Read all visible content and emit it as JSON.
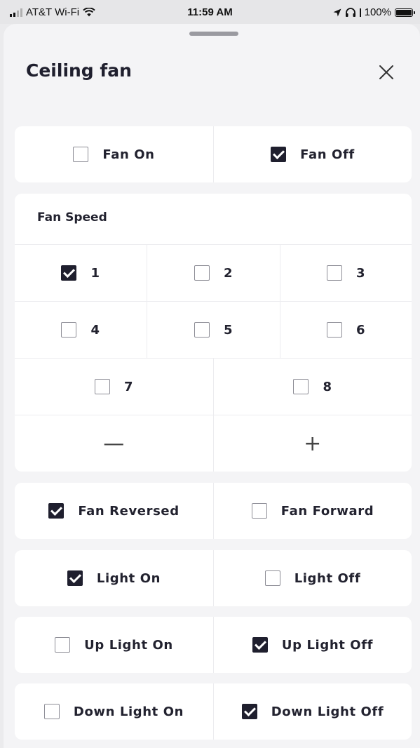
{
  "status_bar": {
    "carrier": "AT&T Wi-Fi",
    "time": "11:59 AM",
    "battery": "100%"
  },
  "sheet": {
    "title": "Ceiling fan"
  },
  "fan_power": {
    "on": {
      "label": "Fan On",
      "checked": false
    },
    "off": {
      "label": "Fan Off",
      "checked": true
    }
  },
  "fan_speed": {
    "heading": "Fan Speed",
    "options": [
      {
        "label": "1",
        "checked": true
      },
      {
        "label": "2",
        "checked": false
      },
      {
        "label": "3",
        "checked": false
      },
      {
        "label": "4",
        "checked": false
      },
      {
        "label": "5",
        "checked": false
      },
      {
        "label": "6",
        "checked": false
      },
      {
        "label": "7",
        "checked": false
      },
      {
        "label": "8",
        "checked": false
      }
    ],
    "decrease": "—",
    "increase": "+"
  },
  "fan_direction": {
    "reversed": {
      "label": "Fan Reversed",
      "checked": true
    },
    "forward": {
      "label": "Fan Forward",
      "checked": false
    }
  },
  "light": {
    "on": {
      "label": "Light On",
      "checked": true
    },
    "off": {
      "label": "Light Off",
      "checked": false
    }
  },
  "up_light": {
    "on": {
      "label": "Up Light On",
      "checked": false
    },
    "off": {
      "label": "Up Light Off",
      "checked": true
    }
  },
  "down_light": {
    "on": {
      "label": "Down Light On",
      "checked": false
    },
    "off": {
      "label": "Down Light Off",
      "checked": true
    }
  }
}
